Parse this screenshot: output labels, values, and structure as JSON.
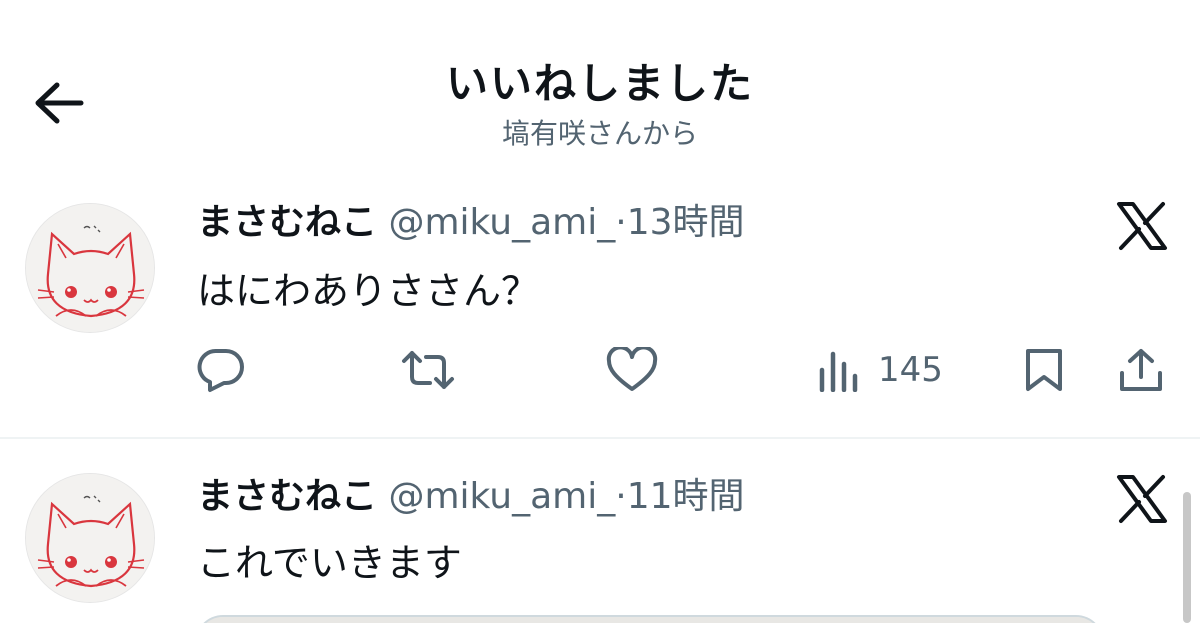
{
  "header": {
    "title": "いいねしました",
    "subtitle": "塙有咲さんから",
    "back_icon": "arrow-left-icon"
  },
  "tweets": [
    {
      "author_name": "まさむねこ",
      "handle": "@miku_ami_",
      "separator": "·",
      "timestamp": "13時間",
      "text": "はにわありささん？",
      "views": "145"
    },
    {
      "author_name": "まさむねこ",
      "handle": "@miku_ami_",
      "separator": "·",
      "timestamp": "11時間",
      "text": "これでいきます"
    }
  ],
  "icons": [
    "x-logo-icon",
    "reply-icon",
    "retweet-icon",
    "like-icon",
    "views-icon",
    "bookmark-icon",
    "share-icon"
  ],
  "colors": {
    "text_primary": "#0f1419",
    "text_secondary": "#536471",
    "divider": "#eff3f4",
    "avatar_line": "#d9363e"
  }
}
